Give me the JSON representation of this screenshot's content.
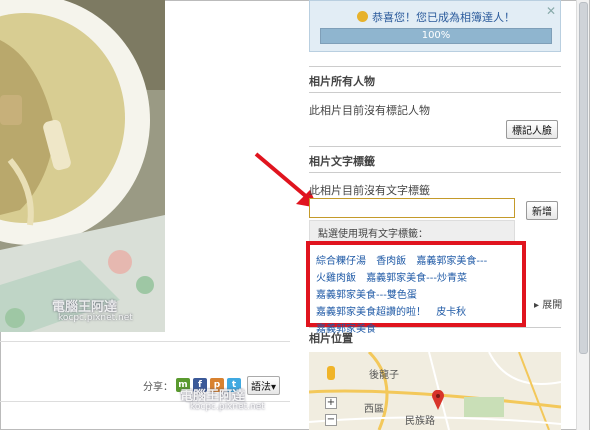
{
  "congrats": {
    "message": "恭喜您！您已成為相簿達人！",
    "close": "✕",
    "progress_label": "100%",
    "progress_fraction": 1.0
  },
  "people": {
    "title": "相片所有人物",
    "empty_text": "此相片目前沒有標記人物",
    "tag_face_button": "標記人臉"
  },
  "text_tags": {
    "title": "相片文字標籤",
    "empty_text": "此相片目前沒有文字標籤",
    "input_value": "",
    "add_button": "新增",
    "suggest_label": "點選使用現有文字標籤："
  },
  "tag_suggestions": [
    "綜合粿仔湯",
    "香肉飯",
    "嘉義郭家美食---",
    "火雞肉飯",
    "嘉義郭家美食---炒青菜",
    "嘉義郭家美食---雙色蛋",
    "嘉義郭家美食超讚的啦！",
    "皮卡秋",
    "嘉義郭家美食"
  ],
  "expand_label": "展開",
  "location": {
    "title": "相片位置",
    "map_labels": [
      "後龍子",
      "西區",
      "民族路"
    ],
    "zoom_in": "+",
    "zoom_out": "−"
  },
  "share": {
    "label": "分享：",
    "icons": [
      "m-icon",
      "facebook-icon",
      "plurk-icon",
      "twitter-icon"
    ],
    "language_button": "語法▾"
  },
  "watermark": {
    "title": "電腦王阿達",
    "url": "kocpc.pixnet.net"
  },
  "colors": {
    "highlight_red": "#e0141e",
    "tag_link": "#1f5aa6",
    "progress": "#8fb5cf"
  }
}
